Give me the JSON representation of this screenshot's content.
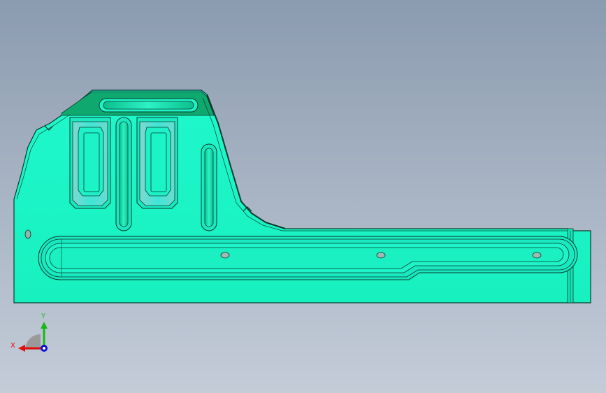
{
  "viewport": {
    "view_mode": "Front",
    "background": {
      "top": "#8b9bb0",
      "bottom": "#c4ccd8"
    }
  },
  "part": {
    "face_color": "#1cf5c8",
    "face_shade": "#14c8a0",
    "slope_color": "#0fa86e",
    "edge_color": "#0a3a2c"
  },
  "triad": {
    "x_label": "X",
    "y_label": "Y",
    "x_color": "#e01010",
    "y_color": "#18b818",
    "z_color": "#1010d0",
    "plane_color": "#9a9a9a"
  }
}
